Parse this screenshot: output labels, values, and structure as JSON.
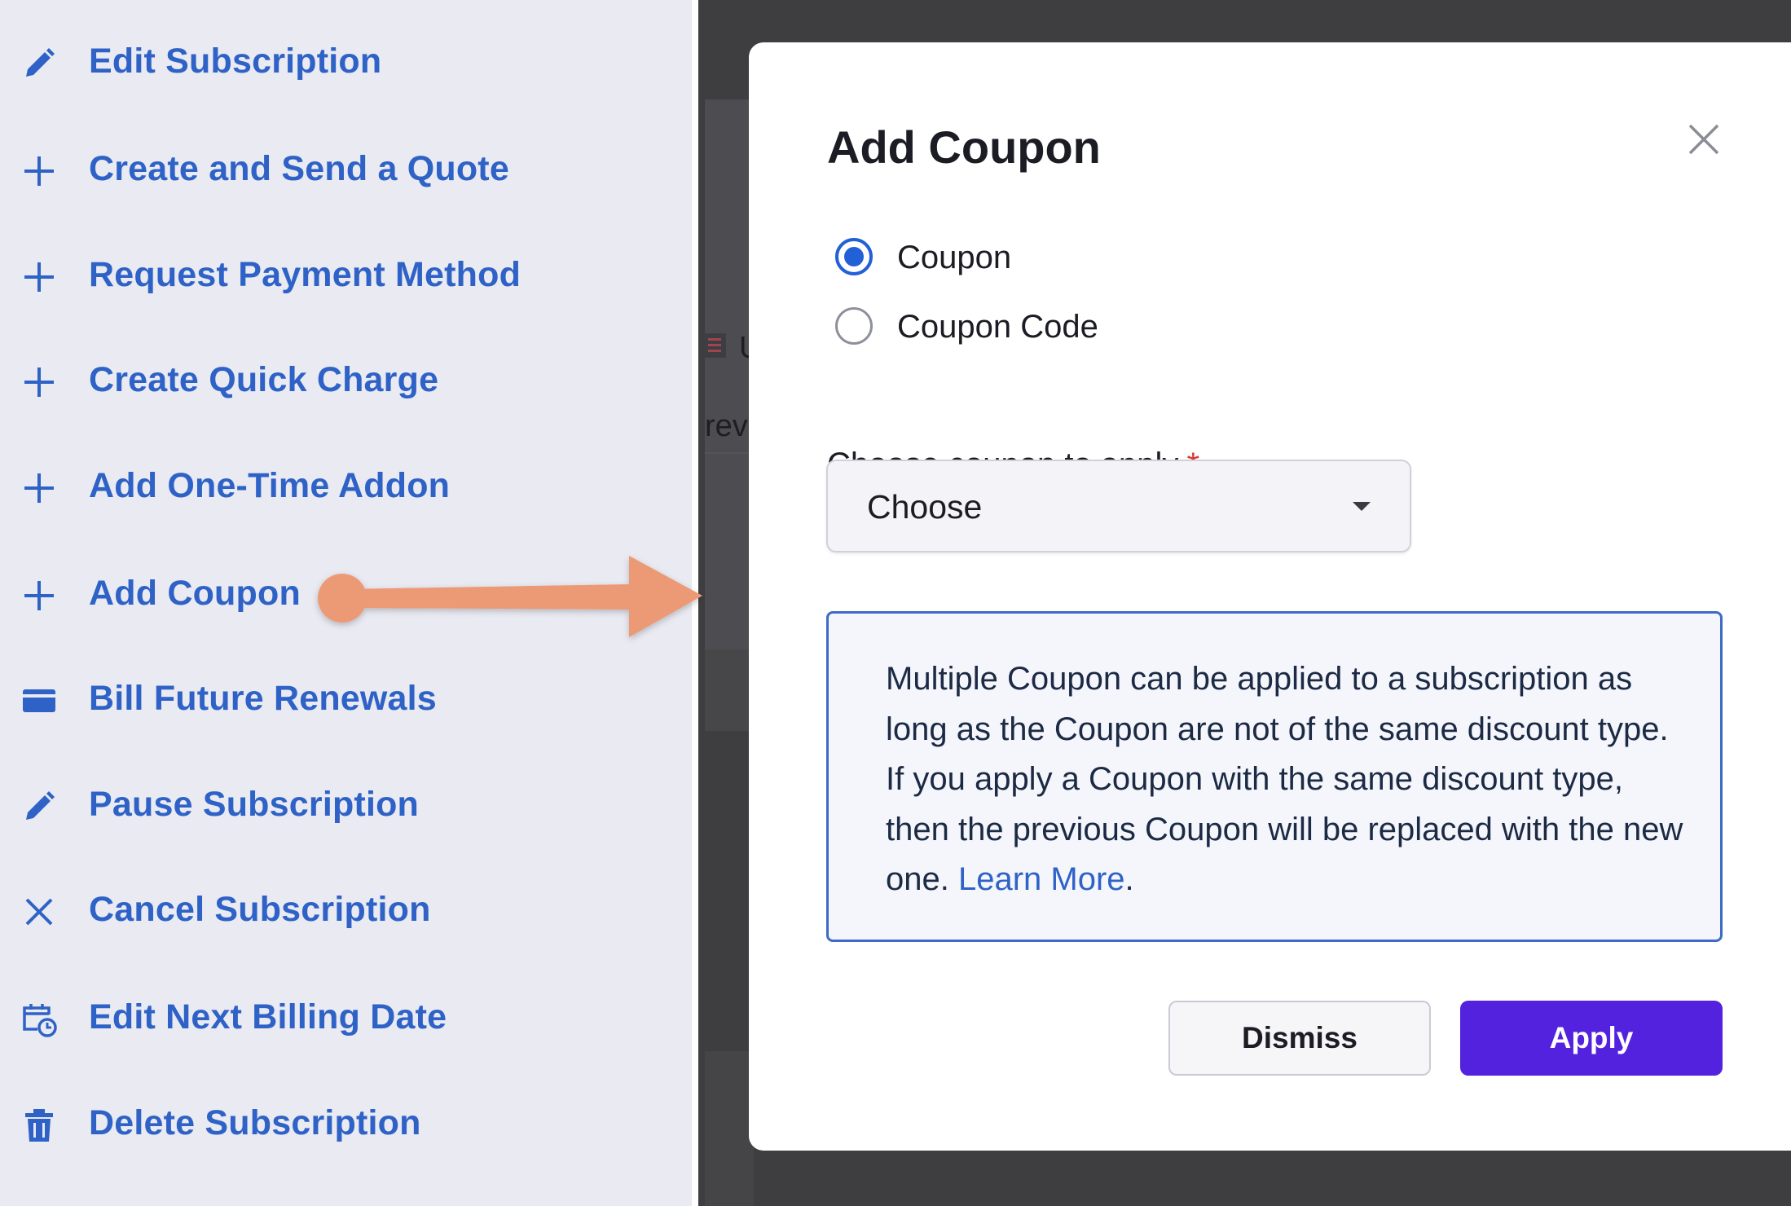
{
  "sidebar": {
    "items": [
      {
        "label": "Edit Subscription",
        "icon": "pencil-icon"
      },
      {
        "label": "Create and Send a Quote",
        "icon": "plus-icon"
      },
      {
        "label": "Request Payment Method",
        "icon": "plus-icon"
      },
      {
        "label": "Create Quick Charge",
        "icon": "plus-icon"
      },
      {
        "label": "Add One-Time Addon",
        "icon": "plus-icon"
      },
      {
        "label": "Add Coupon",
        "icon": "plus-icon"
      },
      {
        "label": "Bill Future Renewals",
        "icon": "card-icon"
      },
      {
        "label": "Pause Subscription",
        "icon": "pencil-icon"
      },
      {
        "label": "Cancel Subscription",
        "icon": "close-icon"
      },
      {
        "label": "Edit Next Billing Date",
        "icon": "calendar-clock-icon"
      },
      {
        "label": "Delete Subscription",
        "icon": "trash-icon"
      }
    ]
  },
  "background": {
    "fragment_flag_text": "U",
    "fragment_text": "rev"
  },
  "modal": {
    "title": "Add Coupon",
    "radios": [
      {
        "label": "Coupon",
        "checked": true
      },
      {
        "label": "Coupon Code",
        "checked": false
      }
    ],
    "field_label": "Choose coupon to apply",
    "required_mark": "*",
    "select_value": "Choose",
    "info_text": "Multiple Coupon can be applied to a subscription as long as the Coupon are not of the same discount type. If you apply a Coupon with the same discount type, then the previous Coupon will be replaced with the new one.",
    "info_link": "Learn More",
    "info_link_suffix": ".",
    "buttons": {
      "dismiss": "Dismiss",
      "apply": "Apply"
    }
  },
  "colors": {
    "accent_blue": "#2f62c6",
    "apply_purple": "#5322de",
    "annotation_arrow": "#ec9a76",
    "required": "#d8372f"
  }
}
